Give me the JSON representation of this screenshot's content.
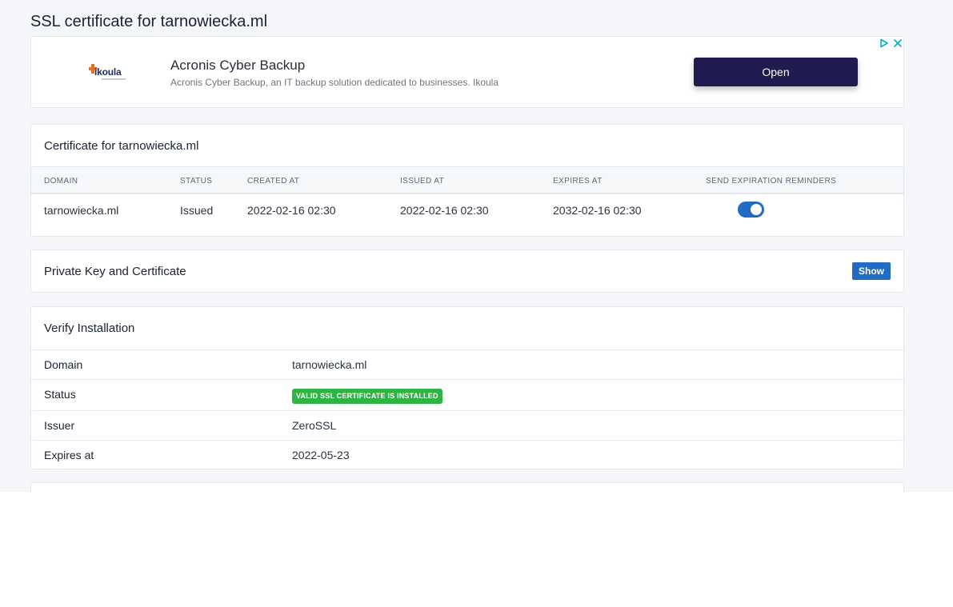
{
  "page": {
    "title": "SSL certificate for tarnowiecka.ml"
  },
  "ad": {
    "logo_text": "ikoula",
    "title": "Acronis Cyber Backup",
    "description": "Acronis Cyber Backup, an IT backup solution dedicated to businesses. Ikoula",
    "open_label": "Open",
    "choices_icons": [
      "ad-choices-icon",
      "close-icon"
    ]
  },
  "certificate": {
    "header": "Certificate for tarnowiecka.ml",
    "columns": [
      "DOMAIN",
      "STATUS",
      "CREATED AT",
      "ISSUED AT",
      "EXPIRES AT",
      "SEND EXPIRATION REMINDERS"
    ],
    "row": {
      "domain": "tarnowiecka.ml",
      "status": "Issued",
      "created_at": "2022-02-16 02:30",
      "issued_at": "2022-02-16 02:30",
      "expires_at": "2032-02-16 02:30",
      "reminders_enabled": true
    }
  },
  "private_key": {
    "header": "Private Key and Certificate",
    "show_label": "Show"
  },
  "verify": {
    "header": "Verify Installation",
    "rows": [
      {
        "label": "Domain",
        "value": "tarnowiecka.ml"
      },
      {
        "label": "Status",
        "value": "VALID SSL CERTIFICATE IS INSTALLED"
      },
      {
        "label": "Issuer",
        "value": "ZeroSSL"
      },
      {
        "label": "Expires at",
        "value": "2022-05-23"
      }
    ]
  },
  "colors": {
    "primary": "#206bc4",
    "success": "#2fb344",
    "ad_button": "#1f1b4f",
    "background": "#f4f6fa"
  }
}
